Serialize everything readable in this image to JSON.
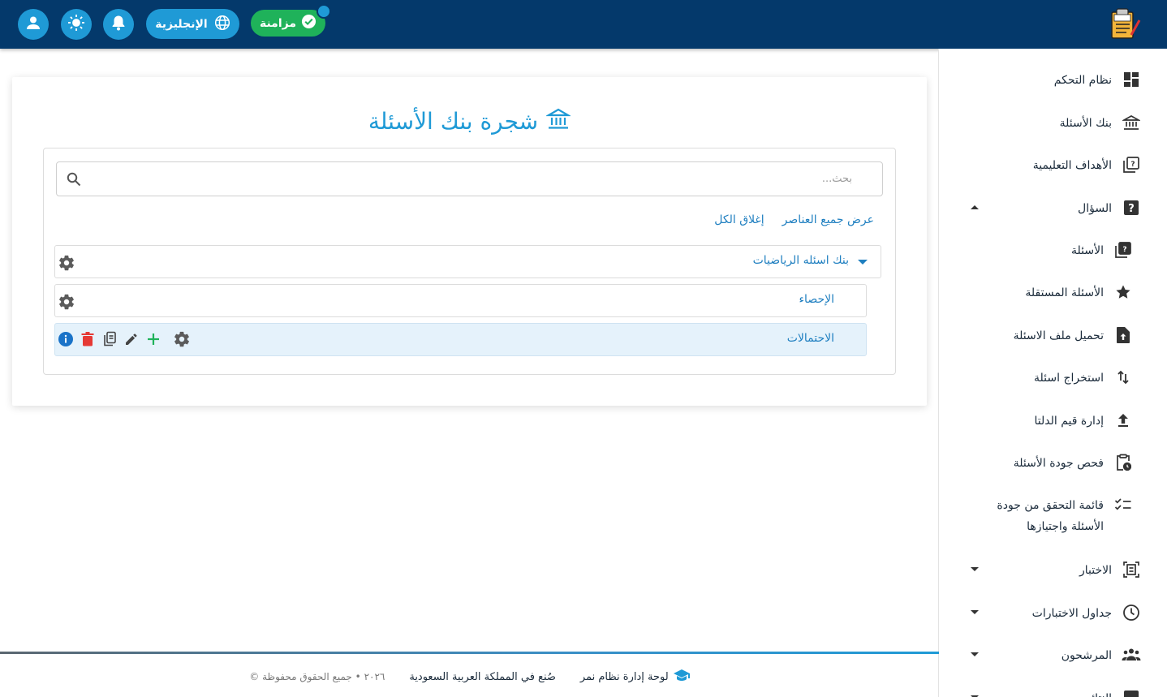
{
  "header": {
    "sync_label": "مزامنة",
    "language_label": "الإنجليزية"
  },
  "page": {
    "title": "شجرة بنك الأسئلة",
    "search_placeholder": "بحث...",
    "show_all_label": "عرض جميع العناصر",
    "close_all_label": "إغلاق الكل"
  },
  "tree": {
    "root_label": "بنك اسئله الرياضيات",
    "children": [
      {
        "label": "الإحصاء"
      },
      {
        "label": "الاحتمالات"
      }
    ]
  },
  "sidebar": {
    "items": [
      {
        "label": "نظام التحكم",
        "icon": "dashboard-icon"
      },
      {
        "label": "بنك الأسئلة",
        "icon": "bank-icon"
      },
      {
        "label": "الأهداف التعليمية",
        "icon": "quiz-icon"
      },
      {
        "label": "السؤال",
        "icon": "help-icon",
        "expanded": true
      },
      {
        "label": "الأسئلة",
        "icon": "quiz-icon"
      },
      {
        "label": "الأسئلة المستقلة",
        "icon": "star-icon"
      },
      {
        "label": "تحميل ملف الاسئلة",
        "icon": "file-upload-icon"
      },
      {
        "label": "استخراج اسئلة",
        "icon": "swap-icon"
      },
      {
        "label": "إدارة قيم الدلتا",
        "icon": "upload-icon"
      },
      {
        "label": "فحص جودة الأسئلة",
        "icon": "clipboard-clock-icon"
      },
      {
        "label_line1": "قائمة التحقق من جودة",
        "label_line2": "الأسئلة واجتيازها",
        "icon": "checklist-icon"
      },
      {
        "label": "الاختبار",
        "icon": "exam-icon"
      },
      {
        "label": "جداول الاختبارات",
        "icon": "clock-icon"
      },
      {
        "label": "المرشحون",
        "icon": "people-icon"
      },
      {
        "label": "النتائج",
        "icon": "results-icon"
      }
    ]
  },
  "footer": {
    "panel_name": "لوحة إدارة نظام نمر",
    "made_in": "صُنع في المملكة العربية السعودية",
    "copyright": "© ٢٠٢٦ • جميع الحقوق محفوظة"
  },
  "colors": {
    "header_bg": "#04396b",
    "accent": "#1f9ad6",
    "success": "#1fb25a",
    "danger": "#e53935"
  }
}
